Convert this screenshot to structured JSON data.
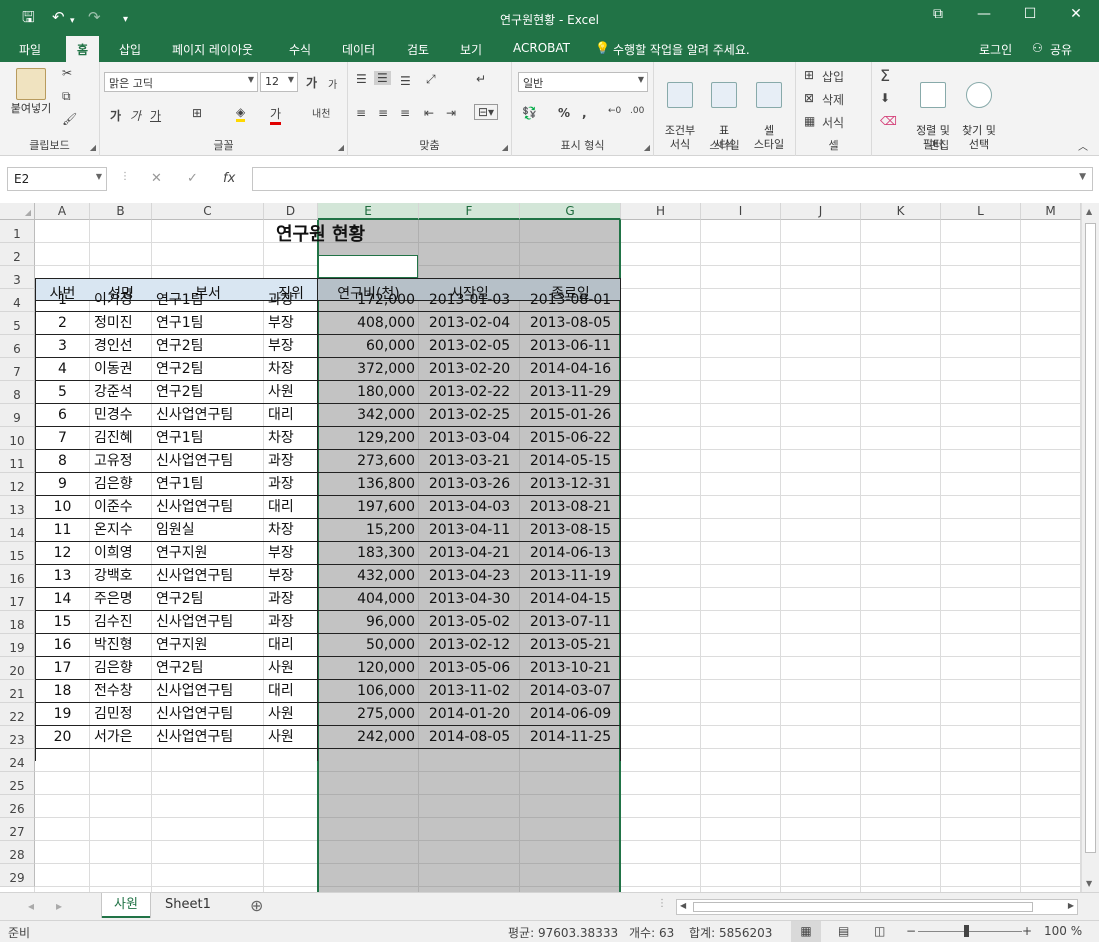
{
  "window": {
    "title": "연구원현황 - Excel",
    "minimize": "—",
    "maximize": "☐",
    "close": "✕",
    "restore_ribbon": "⧉"
  },
  "qat": {
    "save": "🖫",
    "undo": "↶",
    "redo": "↷",
    "customize": "▾"
  },
  "menu": {
    "tabs": [
      "파일",
      "홈",
      "삽입",
      "페이지 레이아웃",
      "수식",
      "데이터",
      "검토",
      "보기",
      "ACROBAT"
    ],
    "active": "홈",
    "tellme": "수행할 작업을 알려 주세요.",
    "login": "로그인",
    "share": "공유"
  },
  "ribbon": {
    "clipboard": {
      "label": "클립보드",
      "paste": "붙여넣기"
    },
    "font": {
      "label": "글꼴",
      "name": "맑은 고딕",
      "size": "12",
      "bold": "가",
      "italic": "가",
      "underline": "가",
      "grow": "가",
      "shrink": "가",
      "fontcolor": "가",
      "phonetic": "내천"
    },
    "alignment": {
      "label": "맞춤"
    },
    "number": {
      "label": "표시 형식",
      "format": "일반"
    },
    "styles": {
      "label": "스타일",
      "conditional": "조건부\n서식",
      "table": "표\n서식",
      "cell": "셀\n스타일"
    },
    "cells": {
      "label": "셀",
      "insert": "삽입",
      "delete": "삭제",
      "format": "서식"
    },
    "editing": {
      "label": "편집",
      "sort": "정렬 및\n필터",
      "find": "찾기 및\n선택"
    }
  },
  "formula_bar": {
    "namebox": "E2",
    "cancel": "✕",
    "enter": "✓",
    "fx": "fx",
    "value": ""
  },
  "columns": [
    "A",
    "B",
    "C",
    "D",
    "E",
    "F",
    "G",
    "H",
    "I",
    "J",
    "K",
    "L",
    "M"
  ],
  "selected_columns": [
    "E",
    "F",
    "G"
  ],
  "rows": [
    "1",
    "2",
    "3",
    "4",
    "5",
    "6",
    "7",
    "8",
    "9",
    "10",
    "11",
    "12",
    "13",
    "14",
    "15",
    "16",
    "17",
    "18",
    "19",
    "20",
    "21",
    "22",
    "23",
    "24",
    "25",
    "26",
    "27",
    "28",
    "29"
  ],
  "sheet": {
    "title": "연구원 현황",
    "headers": [
      "사번",
      "성명",
      "부서",
      "직위",
      "연구비(천)",
      "시작일",
      "종료일"
    ],
    "records": [
      [
        "1",
        "이기정",
        "연구1팀",
        "과장",
        "172,000",
        "2013-01-03",
        "2013-08-01"
      ],
      [
        "2",
        "정미진",
        "연구1팀",
        "부장",
        "408,000",
        "2013-02-04",
        "2013-08-05"
      ],
      [
        "3",
        "경인선",
        "연구2팀",
        "부장",
        "60,000",
        "2013-02-05",
        "2013-06-11"
      ],
      [
        "4",
        "이동권",
        "연구2팀",
        "차장",
        "372,000",
        "2013-02-20",
        "2014-04-16"
      ],
      [
        "5",
        "강준석",
        "연구2팀",
        "사원",
        "180,000",
        "2013-02-22",
        "2013-11-29"
      ],
      [
        "6",
        "민경수",
        "신사업연구팀",
        "대리",
        "342,000",
        "2013-02-25",
        "2015-01-26"
      ],
      [
        "7",
        "김진혜",
        "연구1팀",
        "차장",
        "129,200",
        "2013-03-04",
        "2015-06-22"
      ],
      [
        "8",
        "고유정",
        "신사업연구팀",
        "과장",
        "273,600",
        "2013-03-21",
        "2014-05-15"
      ],
      [
        "9",
        "김은향",
        "연구1팀",
        "과장",
        "136,800",
        "2013-03-26",
        "2013-12-31"
      ],
      [
        "10",
        "이준수",
        "신사업연구팀",
        "대리",
        "197,600",
        "2013-04-03",
        "2013-08-21"
      ],
      [
        "11",
        "온지수",
        "임원실",
        "차장",
        "15,200",
        "2013-04-11",
        "2013-08-15"
      ],
      [
        "12",
        "이희영",
        "연구지원",
        "부장",
        "183,300",
        "2013-04-21",
        "2014-06-13"
      ],
      [
        "13",
        "강백호",
        "신사업연구팀",
        "부장",
        "432,000",
        "2013-04-23",
        "2013-11-19"
      ],
      [
        "14",
        "주은명",
        "연구2팀",
        "과장",
        "404,000",
        "2013-04-30",
        "2014-04-15"
      ],
      [
        "15",
        "김수진",
        "신사업연구팀",
        "과장",
        "96,000",
        "2013-05-02",
        "2013-07-11"
      ],
      [
        "16",
        "박진형",
        "연구지원",
        "대리",
        "50,000",
        "2013-02-12",
        "2013-05-21"
      ],
      [
        "17",
        "김은향",
        "연구2팀",
        "사원",
        "120,000",
        "2013-05-06",
        "2013-10-21"
      ],
      [
        "18",
        "전수창",
        "신사업연구팀",
        "대리",
        "106,000",
        "2013-11-02",
        "2014-03-07"
      ],
      [
        "19",
        "김민정",
        "신사업연구팀",
        "사원",
        "275,000",
        "2014-01-20",
        "2014-06-09"
      ],
      [
        "20",
        "서가은",
        "신사업연구팀",
        "사원",
        "242,000",
        "2014-08-05",
        "2014-11-25"
      ]
    ]
  },
  "tabs": {
    "sheets": [
      "사원",
      "Sheet1"
    ],
    "active": "사원",
    "add": "⊕",
    "prev": "◂",
    "next": "▸"
  },
  "status": {
    "ready": "준비",
    "average": "평균: 97603.38333",
    "count": "개수: 63",
    "sum": "합계: 5856203",
    "zoom": "100 %",
    "zoom_minus": "−",
    "zoom_plus": "+"
  },
  "colors": {
    "accent": "#217346",
    "header_fill": "#d9e6f2",
    "selection": "#217346"
  }
}
